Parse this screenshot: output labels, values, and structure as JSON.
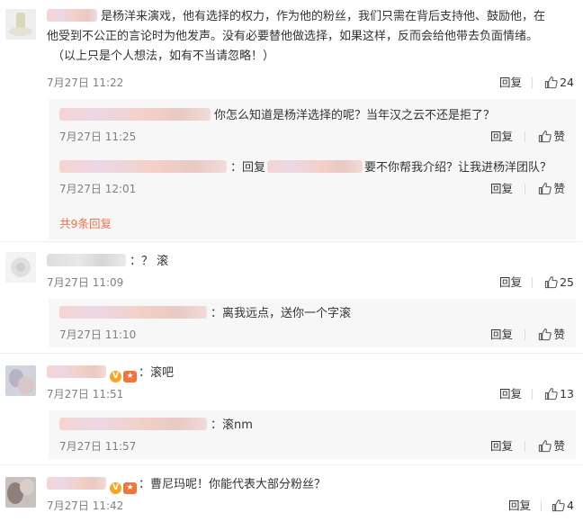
{
  "comments": [
    {
      "text": "是杨洋来演戏，他有选择的权力，作为他的粉丝，我们只需在背后支持他、鼓励他，在他受到不公正的言论时为他发声。没有必要替他做选择，如果这样，反而会给他带去负面情绪。（以上只是个人想法，如有不当请忽略！）",
      "line1": "是杨洋来演戏，他有选择的权力，作为他的粉丝，我们只需在背后支持他、鼓励他，在",
      "line2": "他受到不公正的言论时为他发声。没有必要替他做选择，如果这样，反而会给他带去负面情绪。",
      "line3": "（以上只是个人想法，如有不当请忽略！）",
      "time": "7月27日 11:22",
      "reply_label": "回复",
      "likes": "24",
      "replies": [
        {
          "text": "你怎么知道是杨洋选择的呢？当年汉之云不还是拒了？",
          "time": "7月27日 11:25",
          "reply_label": "回复",
          "like_label": "赞"
        },
        {
          "prefix": "：回复",
          "suffix": "要不你帮我介绍？让我进杨洋团队？",
          "time": "7月27日 12:01",
          "reply_label": "回复",
          "like_label": "赞"
        }
      ],
      "more_label": "共9条回复"
    },
    {
      "text": "：？ 滚",
      "time": "7月27日 11:09",
      "reply_label": "回复",
      "likes": "25",
      "replies": [
        {
          "text": "：离我远点，送你一个字滚",
          "time": "7月27日 11:10",
          "reply_label": "回复",
          "like_label": "赞"
        }
      ]
    },
    {
      "text": "：滚吧",
      "time": "7月27日 11:51",
      "reply_label": "回复",
      "likes": "13",
      "replies": [
        {
          "text": "：滚nm",
          "time": "7月27日 11:57",
          "reply_label": "回复",
          "like_label": "赞"
        }
      ]
    },
    {
      "text": "：曹尼玛呢！你能代表大部分粉丝？",
      "time": "7月27日 11:42",
      "reply_label": "回复",
      "likes": "4"
    }
  ],
  "colors": {
    "accent": "#eb7350",
    "reply_bg": "#f7f7f7",
    "meta_text": "#808080"
  },
  "icons": {
    "like": "thumbs-up-icon",
    "vip": "vip-badge-icon",
    "fan": "fan-badge-icon"
  }
}
